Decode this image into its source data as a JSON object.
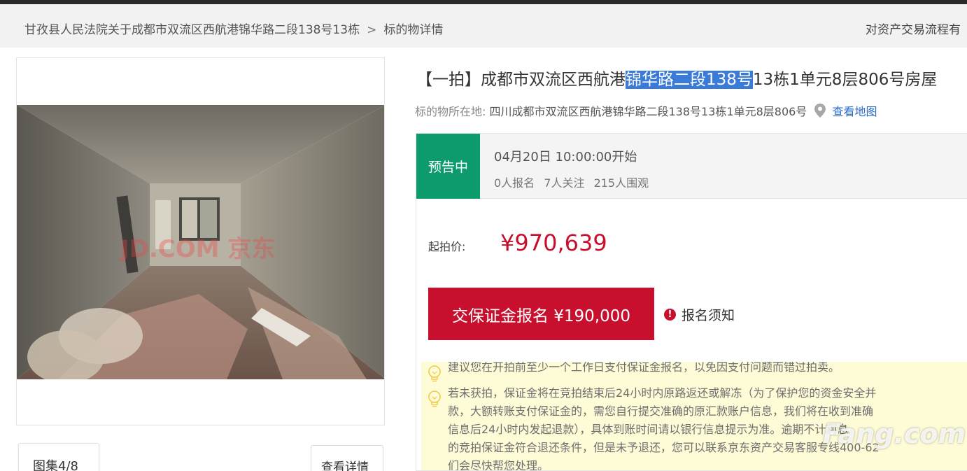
{
  "breadcrumb": {
    "items": [
      "甘孜县人民法院关于成都市双流区西航港锦华路二段138号13栋",
      "标的物详情"
    ],
    "separator": ">"
  },
  "header": {
    "right_link": "对资产交易流程有"
  },
  "gallery": {
    "photo_watermark": "JD.COM 京东",
    "album_label": "图集4/8",
    "detail_label": "查看详情"
  },
  "listing": {
    "title_prefix": "【一拍】成都市双流区西航港",
    "title_highlight": "锦华路二段138号",
    "title_suffix": "13栋1单元8层806号房屋",
    "location_label": "标的物所在地:",
    "location_value": "四川成都市双流区西航港锦华路二段138号13栋1单元8层806号",
    "map_link": "查看地图"
  },
  "auction": {
    "status_badge": "预告中",
    "start_time": "04月20日 10:00:00开始",
    "signups": "0人报名",
    "followers": "7人关注",
    "viewers": "215人围观",
    "price_label": "起拍价:",
    "price": "¥970,639",
    "deposit_button": "交保证金报名 ¥190,000",
    "notice_label": "报名须知"
  },
  "tips": [
    "建议您在开拍前至少一个工作日支付保证金报名，以免因支付问题而错过拍卖。",
    "若未获拍，保证金将在竞拍结束后24小时内原路返还或解冻（为了保护您的资金安全并",
    "款，大额转账支付保证金的，需您自行提交准确的原汇款账户信息，我们将在收到准确",
    "信息后24小时内发起退款），具体到账时间请以银行信息提示为准。逾期不计利息",
    "的竞拍保证金符合退还条件，但是未予退还，您可以联系京东资产交易客服专线400-62",
    "们会尽快帮您处理。"
  ],
  "site_watermark": "Fang.com",
  "colors": {
    "accent_red": "#c8102e",
    "badge_green": "#0d9b6e",
    "link_blue": "#2b6bc9",
    "highlight_blue": "#3a7ad8",
    "tip_bg": "#fefbd7"
  }
}
